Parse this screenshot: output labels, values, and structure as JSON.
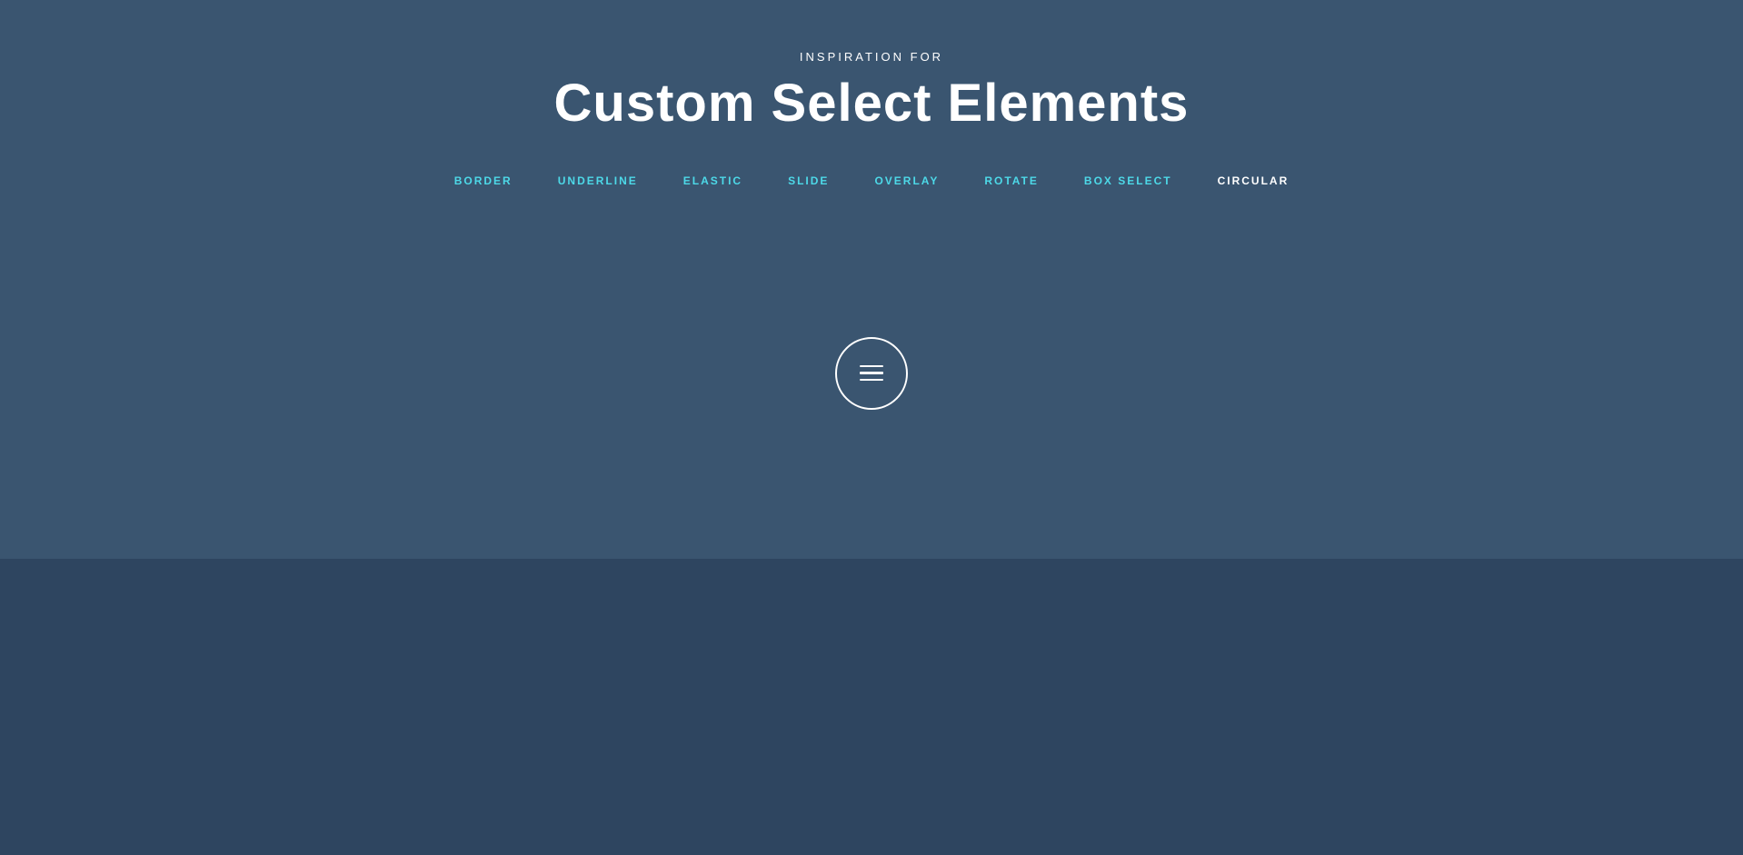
{
  "header": {
    "subtitle": "INSPIRATION FOR",
    "title": "Custom Select Elements"
  },
  "nav": {
    "items": [
      {
        "label": "BORDER",
        "style": "cyan"
      },
      {
        "label": "UNDERLINE",
        "style": "cyan"
      },
      {
        "label": "ELASTIC",
        "style": "cyan"
      },
      {
        "label": "SLIDE",
        "style": "cyan"
      },
      {
        "label": "OVERLAY",
        "style": "cyan"
      },
      {
        "label": "ROTATE",
        "style": "cyan"
      },
      {
        "label": "BOX SELECT",
        "style": "cyan"
      },
      {
        "label": "CIRCULAR",
        "style": "white-bold"
      }
    ]
  },
  "colors": {
    "main_bg": "#3a5570",
    "bottom_bg": "#2e4560",
    "cyan_accent": "#4dd9e8",
    "white": "#ffffff"
  }
}
